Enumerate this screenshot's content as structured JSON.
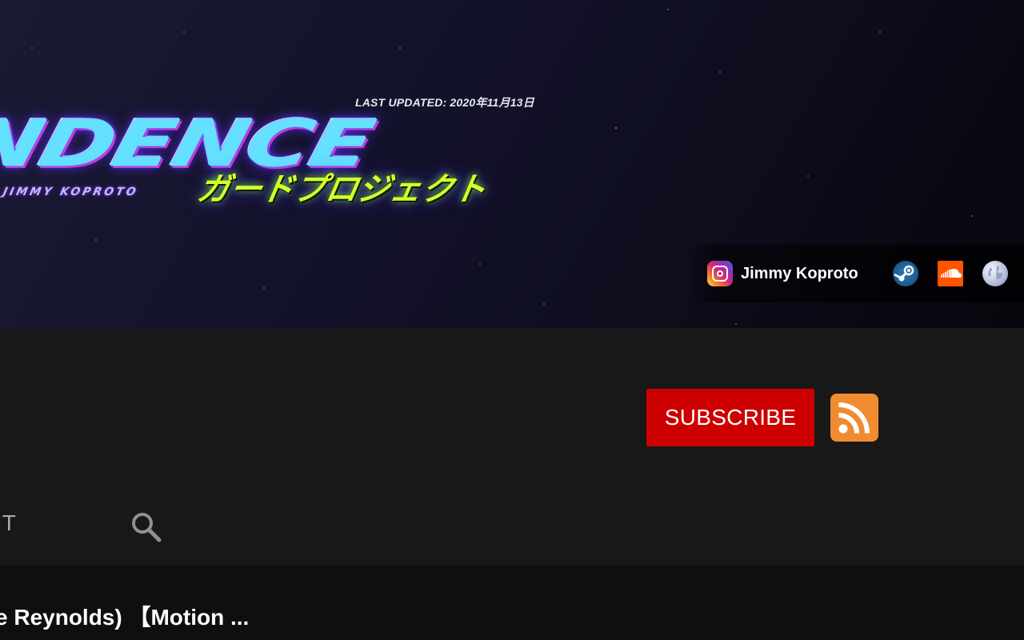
{
  "banner": {
    "last_updated": "LAST UPDATED: 2020年11月13日",
    "logo_title": "NDENCE",
    "logo_byline": "BY JIMMY KOPROTO",
    "logo_japanese": "ガードプロジェクト"
  },
  "social_links": {
    "instagram_label": "Jimmy Koproto",
    "icons": [
      "instagram-icon",
      "steam-icon",
      "soundcloud-icon",
      "globe-icon"
    ]
  },
  "header": {
    "subscribe_label": "SUBSCRIBE",
    "tabs": [
      {
        "label": "UT"
      }
    ]
  },
  "content": {
    "video_title": "e Reynolds) 【Motion ..."
  },
  "colors": {
    "subscribe_red": "#cc0000",
    "rss_orange": "#f18b30",
    "background": "#181818",
    "content_bg": "#0f0f0f"
  }
}
